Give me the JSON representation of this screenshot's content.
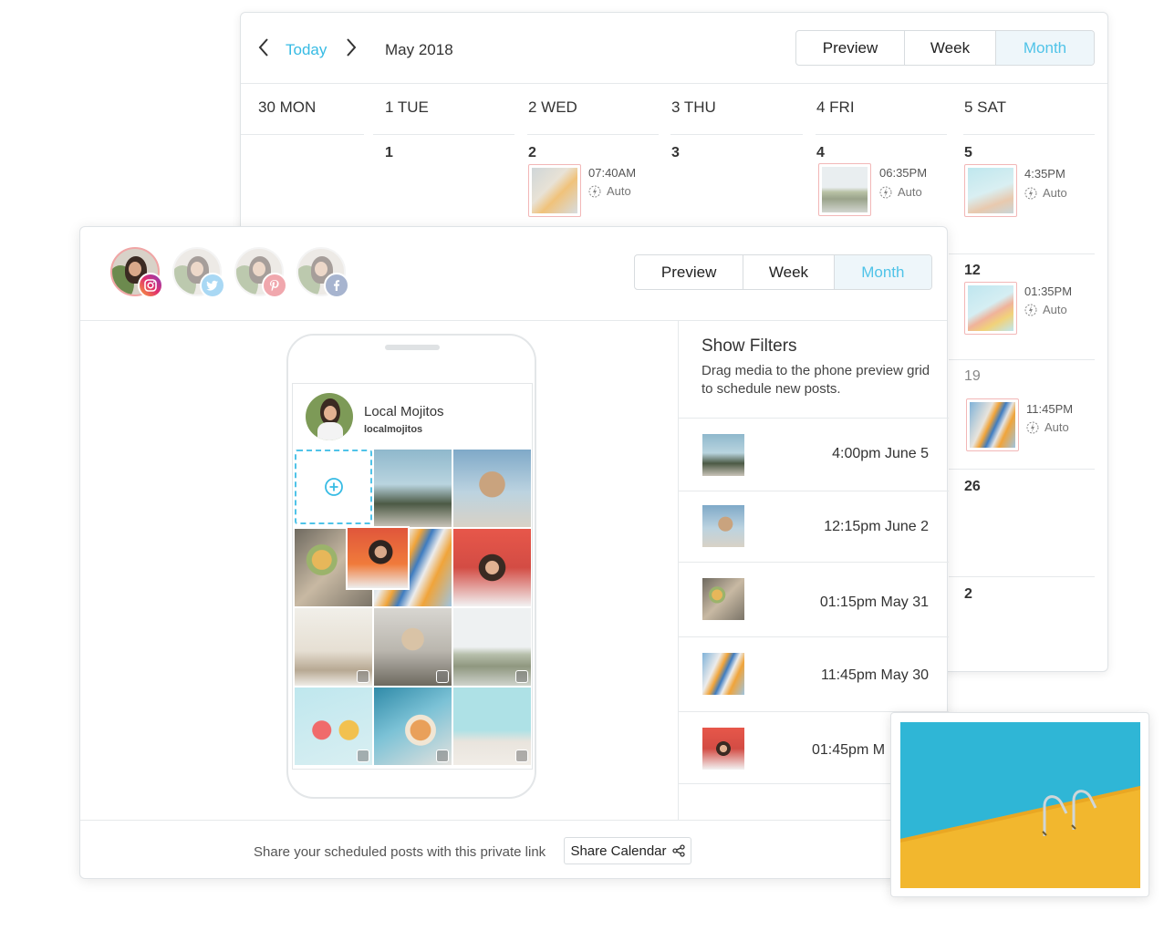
{
  "calendar": {
    "today_label": "Today",
    "month_label": "May 2018",
    "views": [
      "Preview",
      "Week",
      "Month"
    ],
    "active_view": "Month",
    "day_headers": [
      "30 MON",
      "1 TUE",
      "2 WED",
      "3 THU",
      "4 FRI",
      "5 SAT"
    ],
    "week1_dates": [
      "1",
      "2",
      "3",
      "4",
      "5"
    ],
    "sat_dates": [
      "12",
      "19",
      "26",
      "2"
    ],
    "posts": [
      {
        "time": "07:40AM",
        "mode": "Auto"
      },
      {
        "time": "06:35PM",
        "mode": "Auto"
      },
      {
        "time": "4:35PM",
        "mode": "Auto"
      },
      {
        "time": "01:35PM",
        "mode": "Auto"
      },
      {
        "time": "11:45PM",
        "mode": "Auto"
      }
    ]
  },
  "preview": {
    "views": [
      "Preview",
      "Week",
      "Month"
    ],
    "active_view": "Month",
    "profile_name": "Local Mojitos",
    "profile_handle": "localmojitos",
    "filters_title": "Show Filters",
    "filters_desc": "Drag media to the phone preview grid to schedule new posts.",
    "queue": [
      "4:00pm June 5",
      "12:15pm June 2",
      "01:15pm May 31",
      "11:45pm May 30",
      "01:45pm M"
    ],
    "share_text": "Share your scheduled posts with this private link",
    "share_button": "Share Calendar"
  },
  "colors": {
    "accent": "#37bbe4",
    "instagram": "#e1306c",
    "twitter": "#1da1f2",
    "pinterest": "#e60023",
    "facebook": "#3b5998"
  }
}
